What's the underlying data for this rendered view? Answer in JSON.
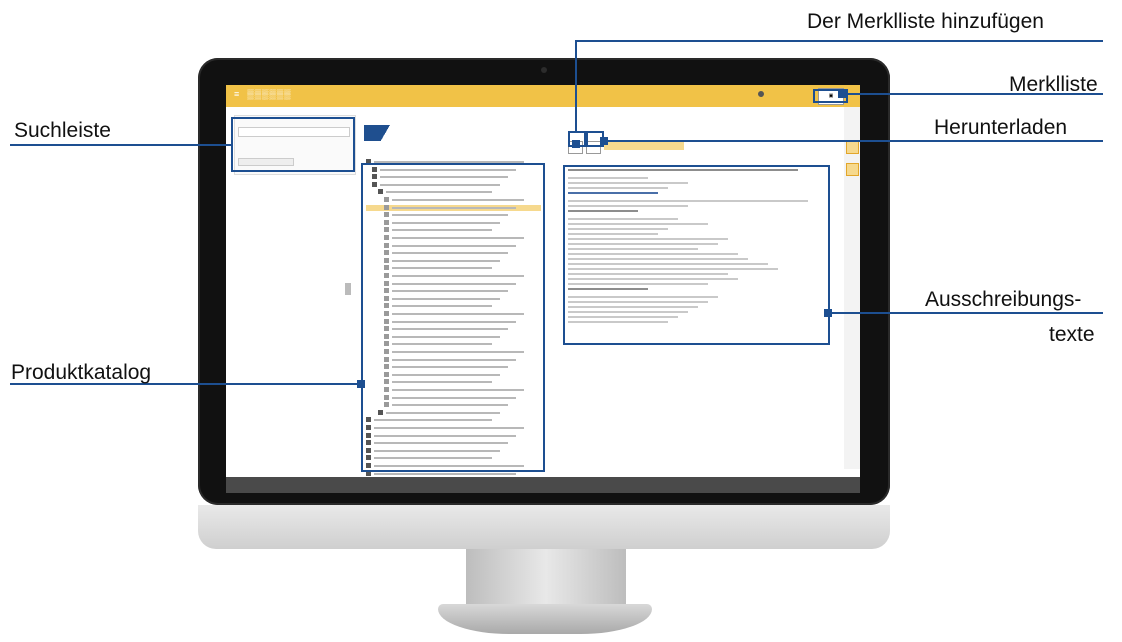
{
  "callouts": {
    "merkliste_add": "Der Merklliste hinzufügen",
    "merkliste": "Merklliste",
    "suchleiste": "Suchleiste",
    "herunterladen": "Herunterladen",
    "ausschreibungstexte_1": "Ausschreibungs-",
    "ausschreibungstexte_2": "texte",
    "produktkatalog": "Produktkatalog"
  },
  "colors": {
    "accent": "#f1c247",
    "callout": "#1d4f91",
    "bezel": "#111111"
  },
  "icons": [
    "folder-icon",
    "document-icon",
    "download-icon",
    "bookmark-icon",
    "account-icon",
    "search-icon",
    "filter-icon"
  ]
}
